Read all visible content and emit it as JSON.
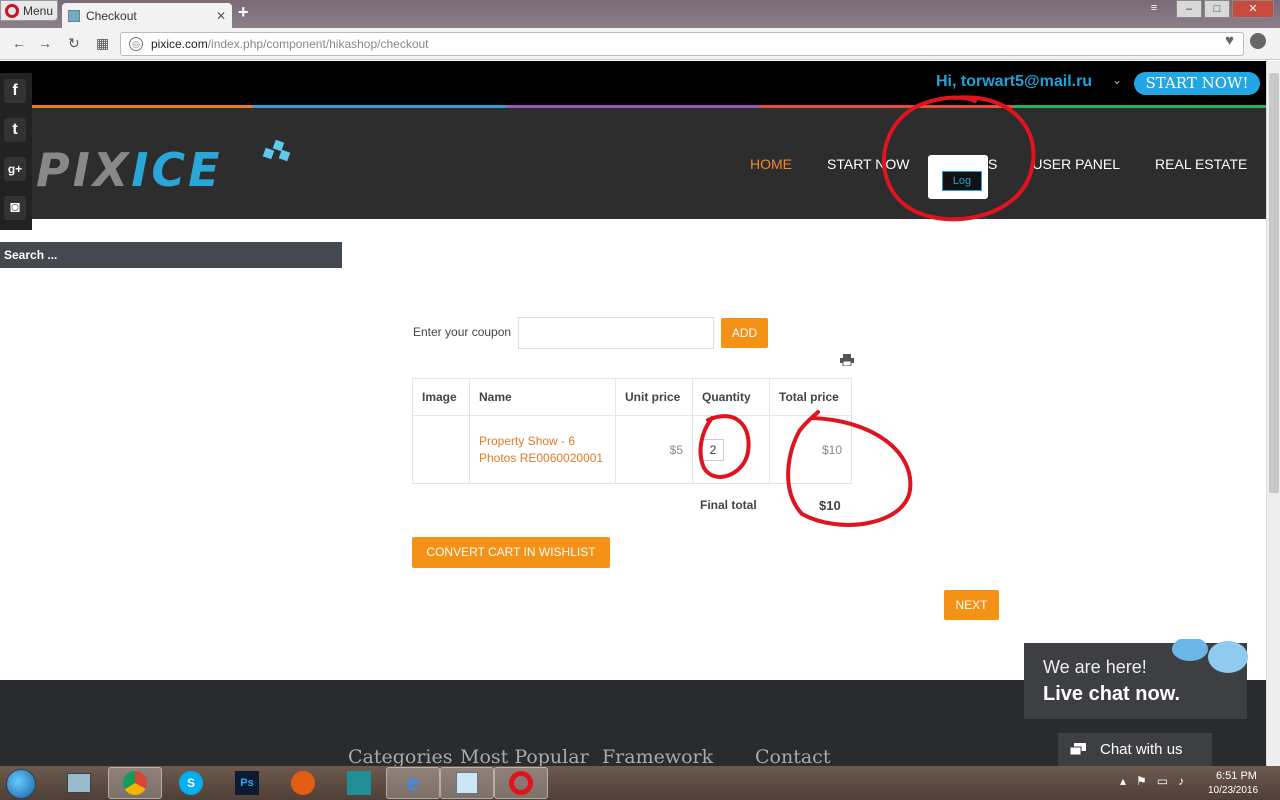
{
  "browser": {
    "menu_label": "Menu",
    "tab_title": "Checkout",
    "tab_close": "✕",
    "new_tab": "+",
    "url_domain": "pixice.com",
    "url_path": "/index.php/component/hikashop/checkout"
  },
  "site": {
    "greeting": "Hi, torwart5@mail.ru",
    "start_now_button": "START NOW!",
    "logo_part1": "PIX",
    "logo_part2": "ICE",
    "login_tooltip": "Log",
    "nav": [
      {
        "label": "HOME",
        "active": true
      },
      {
        "label": "START NOW",
        "active": false
      },
      {
        "label": "VIDEOS",
        "active": false
      },
      {
        "label": "USER PANEL",
        "active": false
      },
      {
        "label": "REAL ESTATE",
        "active": false
      }
    ],
    "social": [
      "f",
      "t",
      "g+",
      "◙"
    ],
    "search_placeholder": "Search ..."
  },
  "checkout": {
    "coupon_label": "Enter your coupon",
    "add_button": "ADD",
    "table_headers": [
      "Image",
      "Name",
      "Unit price",
      "Quantity",
      "Total price"
    ],
    "row": {
      "name": "Property Show - 6 Photos RE0060020001",
      "unit_price": "$5",
      "quantity": "2",
      "total_price": "$10"
    },
    "final_total_label": "Final total",
    "final_total_value": "$10",
    "wishlist_button": "CONVERT CART IN WISHLIST",
    "next_button": "NEXT"
  },
  "footer": {
    "links": [
      "Categories",
      "Most Popular",
      "Framework",
      "Contact"
    ]
  },
  "chat": {
    "line1": "We are here!",
    "line2": "Live chat now.",
    "button": "Chat with us"
  },
  "taskbar": {
    "apps": [
      "explorer",
      "chrome",
      "skype",
      "photoshop",
      "houdini",
      "3dsmax",
      "internet-explorer",
      "notes",
      "opera"
    ],
    "time": "6:51 PM",
    "date": "10/23/2016"
  },
  "colors": {
    "accent_orange": "#f39216",
    "brand_blue": "#1fa3d9",
    "annotation_red": "#e0141e"
  }
}
